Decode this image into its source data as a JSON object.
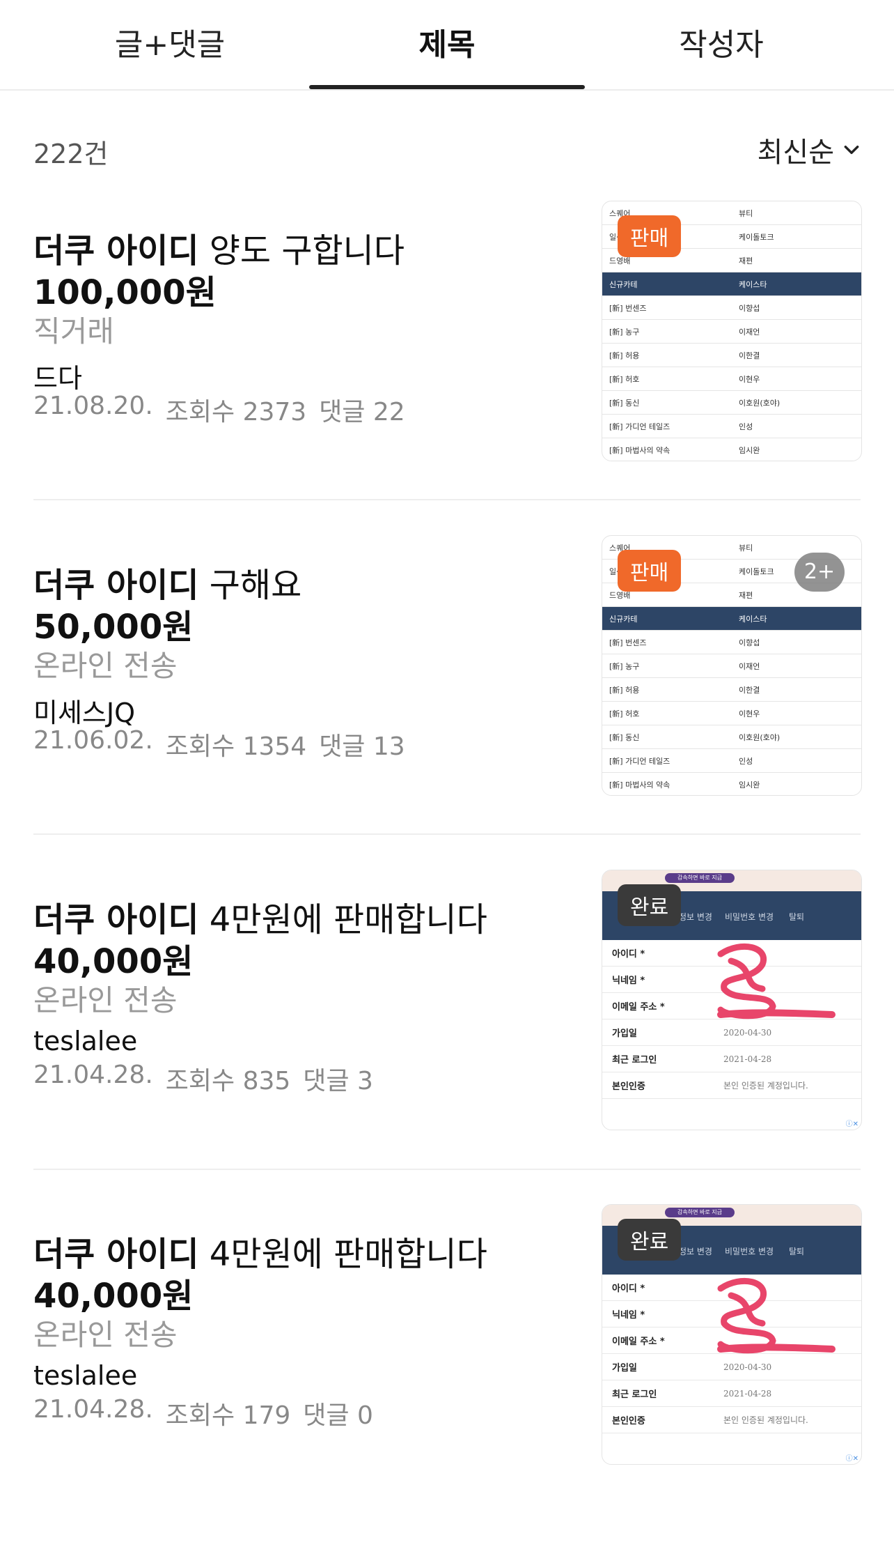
{
  "tabs": [
    {
      "label": "글+댓글"
    },
    {
      "label": "제목"
    },
    {
      "label": "작성자"
    }
  ],
  "result_count": "222건",
  "sort_label": "최신순",
  "items": [
    {
      "title_highlight": "더쿠 아이디",
      "title_rest": " 양도 구합니다",
      "price": "100,000원",
      "method": "직거래",
      "author": "드다",
      "date": "21.08.20.",
      "views": "조회수 2373",
      "comments": "댓글 22",
      "badge": "판매",
      "extra_count": ""
    },
    {
      "title_highlight": "더쿠 아이디",
      "title_rest": " 구해요",
      "price": "50,000원",
      "method": "온라인 전송",
      "author": "미세스JQ",
      "date": "21.06.02.",
      "views": "조회수 1354",
      "comments": "댓글 13",
      "badge": "판매",
      "extra_count": "2+"
    },
    {
      "title_highlight": "더쿠 아이디",
      "title_rest": " 4만원에 판매합니다",
      "price": "40,000원",
      "method": "온라인 전송",
      "author": "teslalee",
      "date": "21.04.28.",
      "views": "조회수 835",
      "comments": "댓글 3",
      "badge": "완료",
      "extra_count": ""
    },
    {
      "title_highlight": "더쿠 아이디",
      "title_rest": " 4만원에 판매합니다",
      "price": "40,000원",
      "method": "온라인 전송",
      "author": "teslalee",
      "date": "21.04.28.",
      "views": "조회수 179",
      "comments": "댓글 0",
      "badge": "완료",
      "extra_count": ""
    }
  ],
  "thumb_table": {
    "rows": [
      [
        "스퀘어",
        "뷰티"
      ],
      [
        "일상",
        "케이돌토크"
      ],
      [
        "드영배",
        "재편"
      ],
      [
        "신규카테",
        "케이스타"
      ],
      [
        "[新] 번센즈",
        "이향섭"
      ],
      [
        "[新] 농구",
        "이재언"
      ],
      [
        "[新] 허용",
        "이한결"
      ],
      [
        "[新] 허호",
        "이현우"
      ],
      [
        "[新] 동신",
        "이호원(호야)"
      ],
      [
        "[新] 가디언 테일즈",
        "인성"
      ],
      [
        "[新] 마법사의 약속",
        "임시완"
      ]
    ]
  },
  "thumb_form": {
    "banner": "감속하면 바로 지급",
    "tabs": [
      "정보 변경",
      "비밀번호 변경",
      "탈퇴"
    ],
    "rows": [
      {
        "k": "아이디 *",
        "v": ""
      },
      {
        "k": "닉네임 *",
        "v": ""
      },
      {
        "k": "이메일 주소 *",
        "v": ""
      },
      {
        "k": "가입일",
        "v": "2020-04-30"
      },
      {
        "k": "최근 로그인",
        "v": "2021-04-28"
      },
      {
        "k": "본인인증",
        "v": "본인 인증된 계정입니다."
      }
    ],
    "ad_mark": "ⓘ✕"
  },
  "colors": {
    "sale_badge": "#f0692a",
    "done_badge": "#3a3a3a",
    "table_header": "#2d4566",
    "scribble": "#e8456a"
  }
}
